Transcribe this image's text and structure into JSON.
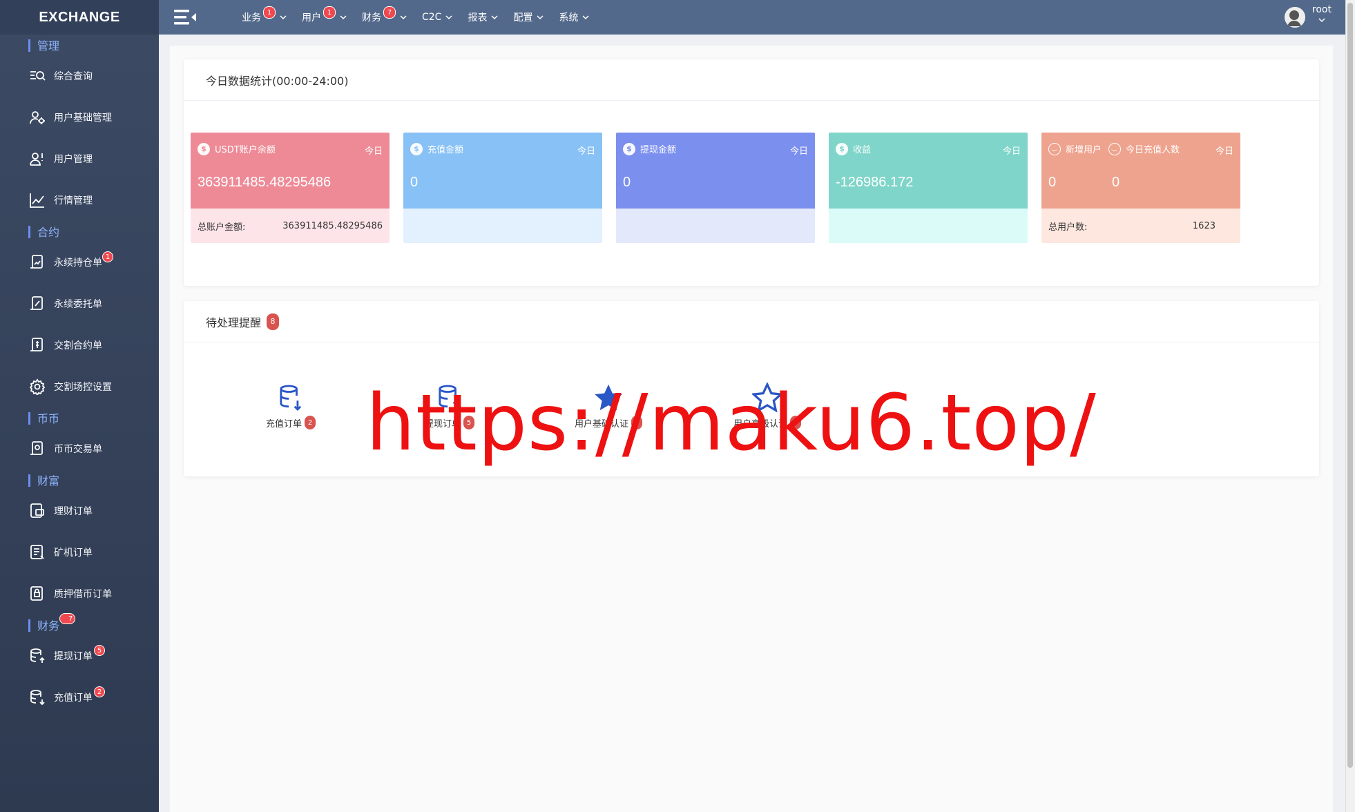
{
  "brand": "EXCHANGE",
  "sidebar": {
    "sections": [
      {
        "title": "管理",
        "items": [
          {
            "label": "综合查询",
            "icon": "search-list-icon"
          },
          {
            "label": "用户基础管理",
            "icon": "user-gear-icon"
          },
          {
            "label": "用户管理",
            "icon": "user-alert-icon"
          },
          {
            "label": "行情管理",
            "icon": "line-chart-icon"
          }
        ]
      },
      {
        "title": "合约",
        "items": [
          {
            "label": "永续持仓单",
            "icon": "doc-chart-icon",
            "badge": "1"
          },
          {
            "label": "永续委托单",
            "icon": "doc-pen-icon"
          },
          {
            "label": "交割合约单",
            "icon": "doc-dollar-icon"
          },
          {
            "label": "交割场控设置",
            "icon": "gear-icon"
          }
        ]
      },
      {
        "title": "币币",
        "items": [
          {
            "label": "币币交易单",
            "icon": "doc-coin-icon"
          }
        ]
      },
      {
        "title": "财富",
        "items": [
          {
            "label": "理财订单",
            "icon": "doc-wallet-icon"
          },
          {
            "label": "矿机订单",
            "icon": "doc-list-icon"
          },
          {
            "label": "质押借币订单",
            "icon": "doc-lock-icon"
          }
        ]
      },
      {
        "title": "财务",
        "badge": "7",
        "items": [
          {
            "label": "提现订单",
            "icon": "database-up-icon",
            "badge": "5"
          },
          {
            "label": "充值订单",
            "icon": "database-down-icon",
            "badge": "2"
          }
        ]
      }
    ]
  },
  "topnav": [
    {
      "label": "业务",
      "badge": "1"
    },
    {
      "label": "用户",
      "badge": "1"
    },
    {
      "label": "财务",
      "badge": "7"
    },
    {
      "label": "C2C"
    },
    {
      "label": "报表"
    },
    {
      "label": "配置"
    },
    {
      "label": "系统"
    }
  ],
  "user": {
    "name": "root"
  },
  "stats": {
    "title": "今日数据统计(00:00-24:00)",
    "cards": [
      {
        "title": "USDT账户余额",
        "tag": "今日",
        "value": "363911485.48295486",
        "foot_label": "总账户金额:",
        "foot_value": "363911485.48295486",
        "top_color": "#ee8a96",
        "bot_color": "#fde4e8"
      },
      {
        "title": "充值金额",
        "tag": "今日",
        "value": "0",
        "foot_label": "",
        "foot_value": "",
        "top_color": "#88c1f6",
        "bot_color": "#e3f0fd"
      },
      {
        "title": "提现金额",
        "tag": "今日",
        "value": "0",
        "foot_label": "",
        "foot_value": "",
        "top_color": "#7b8fee",
        "bot_color": "#e4e8fb"
      },
      {
        "title": "收益",
        "tag": "今日",
        "value": "-126986.172",
        "foot_label": "",
        "foot_value": "",
        "top_color": "#7fd5c9",
        "bot_color": "#dbfbf9"
      },
      {
        "title": "新增用户",
        "title2": "今日充值人数",
        "tag": "今日",
        "value": "0",
        "value2": "0",
        "foot_label": "总用户数:",
        "foot_value": "1623",
        "top_color": "#eea38e",
        "bot_color": "#fde7df"
      }
    ]
  },
  "pending": {
    "title": "待处理提醒",
    "badge": "8",
    "items": [
      {
        "label": "充值订单",
        "badge": "2",
        "icon": "database-down-icon"
      },
      {
        "label": "提现订单",
        "badge": "5",
        "icon": "database-up-icon"
      },
      {
        "label": "用户基础认证",
        "badge": "0",
        "icon": "star-filled-icon"
      },
      {
        "label": "用户高级认证",
        "badge": "0",
        "icon": "star-outline-icon"
      }
    ]
  },
  "watermark": "https://maku6.top/",
  "colors": {
    "accent": "#2a56c6",
    "badge": "#f0484f",
    "topbar": "#53698b",
    "sidebar": "#34425a"
  }
}
